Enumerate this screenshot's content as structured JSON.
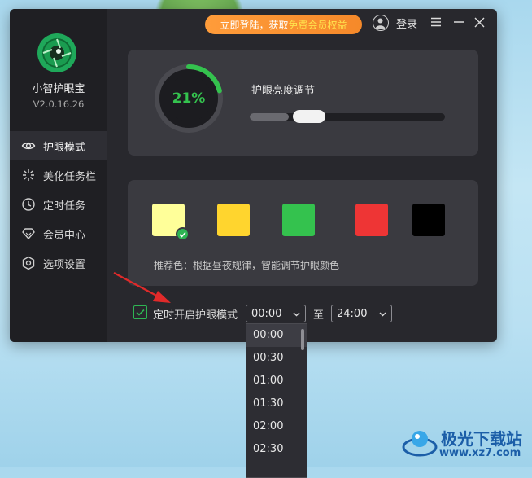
{
  "app": {
    "name": "小智护眼宝",
    "version": "V2.0.16.26"
  },
  "header": {
    "promo_pre": "立即登陆，获取",
    "promo_highlight": "免费会员权益",
    "login_label": "登录"
  },
  "sidebar": {
    "items": [
      {
        "label": "护眼模式",
        "icon": "eye-icon",
        "active": true
      },
      {
        "label": "美化任务栏",
        "icon": "sparkle-icon",
        "active": false
      },
      {
        "label": "定时任务",
        "icon": "clock-icon",
        "active": false
      },
      {
        "label": "会员中心",
        "icon": "diamond-icon",
        "active": false
      },
      {
        "label": "选项设置",
        "icon": "gear-icon",
        "active": false
      }
    ]
  },
  "brightness": {
    "percent_label": "21%",
    "percent": 21,
    "title": "护眼亮度调节",
    "slider_value": 0.2
  },
  "colors": {
    "swatches": [
      {
        "color": "#ffff99",
        "selected": true
      },
      {
        "color": "#ffd52e",
        "selected": false
      },
      {
        "color": "#34c24e",
        "selected": false
      },
      {
        "color": "#ee3535",
        "selected": false
      },
      {
        "color": "#000000",
        "selected": false
      }
    ],
    "recommend_text": "推荐色：根据昼夜规律，智能调节护眼颜色"
  },
  "timer": {
    "checked": true,
    "label": "定时开启护眼模式",
    "start": "00:00",
    "to_label": "至",
    "end": "24:00",
    "options": [
      "00:00",
      "00:30",
      "01:00",
      "01:30",
      "02:00",
      "02:30"
    ],
    "selected_option": "00:00"
  },
  "accent_color": "#2eb553",
  "watermark": {
    "text1": "极光下载站",
    "text2": "www.xz7.com"
  }
}
